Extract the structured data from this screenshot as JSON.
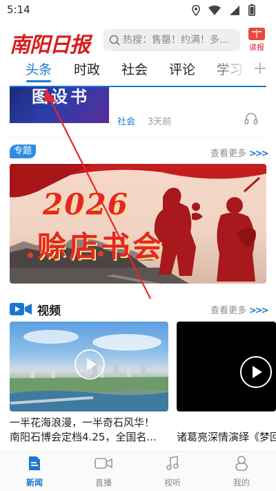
{
  "status_bar": {
    "time": "5:14",
    "icons": [
      "location-icon",
      "wifi-icon",
      "signal-icon",
      "battery-icon"
    ]
  },
  "header": {
    "logo_text": "南阳日报",
    "search_placeholder": "热搜：售罄！约满！多...",
    "reader_label": "读报"
  },
  "tabs": [
    {
      "label": "头条",
      "active": true
    },
    {
      "label": "时政",
      "active": false
    },
    {
      "label": "社会",
      "active": false
    },
    {
      "label": "评论",
      "active": false
    },
    {
      "label": "学习",
      "active": false
    }
  ],
  "add_tab_symbol": "+",
  "article": {
    "image_text": "图设书",
    "category": "社会",
    "time": "3天前"
  },
  "special": {
    "badge": "专题",
    "more": "查看更多",
    "more_arrows": ">>>",
    "banner_year": "2026",
    "banner_title": "赊店书会"
  },
  "video_section": {
    "title": "视频",
    "more": "查看更多",
    "more_arrows": ">>>",
    "items": [
      {
        "title_line1": "一半花海浪漫，一半奇石风华！",
        "title_line2": "南阳石博会定档4.25，全国名..."
      },
      {
        "title_line1": "诸葛亮深情演绎《梦回"
      }
    ]
  },
  "bottom_nav": [
    {
      "label": "新闻",
      "icon": "news-icon",
      "active": true
    },
    {
      "label": "直播",
      "icon": "live-icon",
      "active": false
    },
    {
      "label": "视听",
      "icon": "music-icon",
      "active": false
    },
    {
      "label": "我的",
      "icon": "user-icon",
      "active": false
    }
  ],
  "colors": {
    "accent": "#1b76d1",
    "brand_red": "#d91c1c",
    "annotation": "#e8262a"
  }
}
